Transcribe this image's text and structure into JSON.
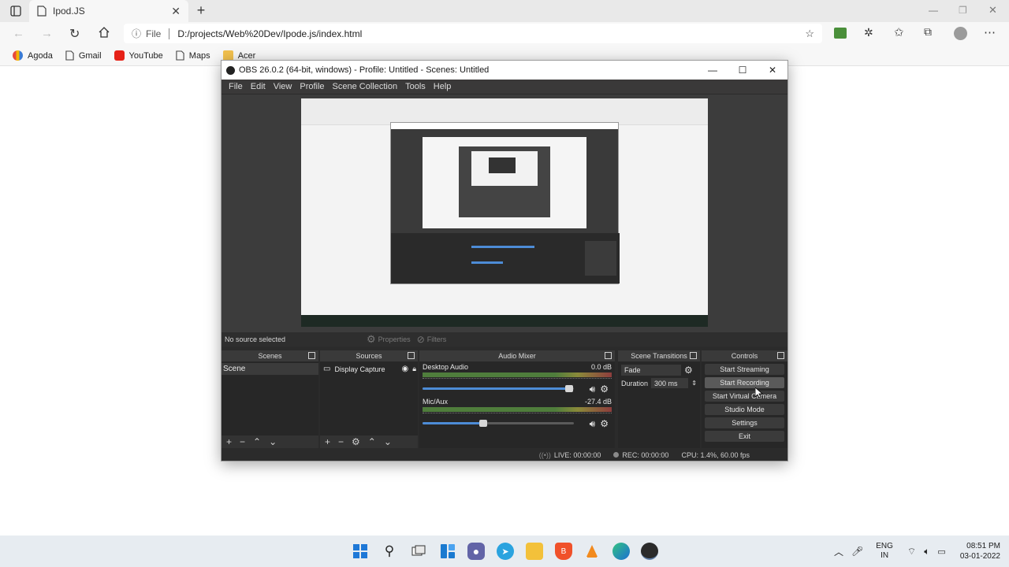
{
  "browser": {
    "tab_title": "Ipod.JS",
    "address_prefix": "File",
    "address": "D:/projects/Web%20Dev/Ipode.js/index.html",
    "bookmarks": [
      "Agoda",
      "Gmail",
      "YouTube",
      "Maps",
      "Acer"
    ]
  },
  "obs": {
    "title": "OBS 26.0.2 (64-bit, windows) - Profile: Untitled - Scenes: Untitled",
    "menu": [
      "File",
      "Edit",
      "View",
      "Profile",
      "Scene Collection",
      "Tools",
      "Help"
    ],
    "source_status": "No source selected",
    "properties_label": "Properties",
    "filters_label": "Filters",
    "docks": {
      "scenes": "Scenes",
      "sources": "Sources",
      "mixer": "Audio Mixer",
      "transitions": "Scene Transitions",
      "controls": "Controls"
    },
    "scene_item": "Scene",
    "source_item": "Display Capture",
    "mixer": [
      {
        "name": "Desktop Audio",
        "db": "0.0 dB",
        "volume": 0.97
      },
      {
        "name": "Mic/Aux",
        "db": "-27.4 dB",
        "volume": 0.4
      }
    ],
    "transition": "Fade",
    "duration_label": "Duration",
    "duration_value": "300 ms",
    "controls": [
      "Start Streaming",
      "Start Recording",
      "Start Virtual Camera",
      "Studio Mode",
      "Settings",
      "Exit"
    ],
    "status": {
      "live": "LIVE: 00:00:00",
      "rec": "REC: 00:00:00",
      "cpu": "CPU: 1.4%, 60.00 fps"
    }
  },
  "taskbar": {
    "lang_top": "ENG",
    "lang_bottom": "IN",
    "time": "08:51 PM",
    "date": "03-01-2022"
  }
}
